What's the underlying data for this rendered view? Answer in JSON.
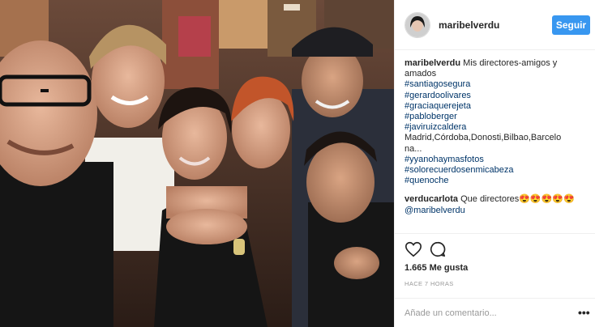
{
  "post": {
    "username": "maribelverdu",
    "follow_label": "Seguir",
    "caption": {
      "username": "maribelverdu",
      "text": "Mis directores-amigos y amados",
      "hashtags_top": [
        "#santiagosegura",
        "#gerardoolivares",
        "#graciaquerejeta",
        "#pabloberger",
        "#javiruizcaldera"
      ],
      "cities_line1": "Madrid,Córdoba,Donosti,Bilbao,Barcelo",
      "cities_line2": "na...",
      "hashtags_bottom": [
        "#yyanohaymasfotos",
        "#solorecuerdosenmicabeza",
        "#quenoche"
      ]
    },
    "comment": {
      "username": "verducarlota",
      "text": "Que directores😍😍😍😍😍",
      "mention": "@maribelverdu"
    },
    "likes": "1.665 Me gusta",
    "time": "HACE 7 HORAS",
    "add_comment_placeholder": "Añade un comentario...",
    "more_label": "•••"
  }
}
